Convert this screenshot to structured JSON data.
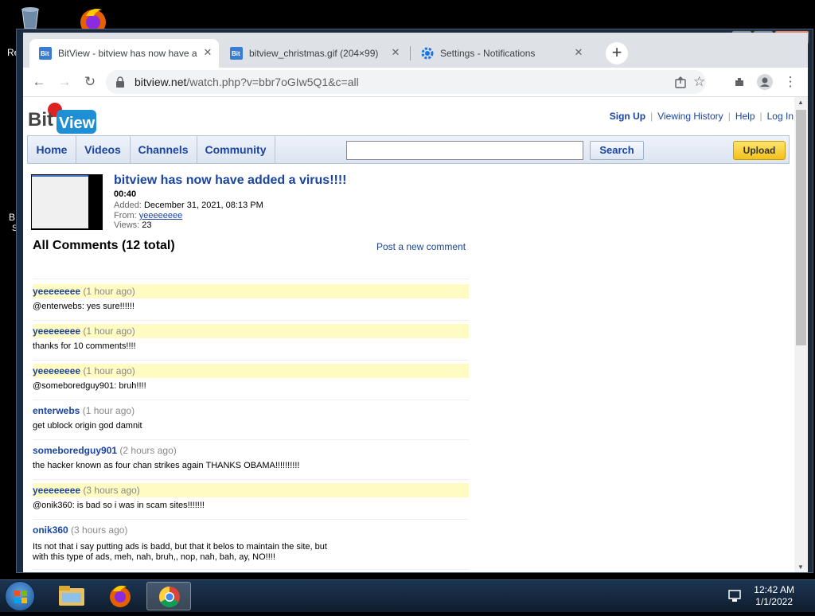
{
  "desktop": {
    "left_fragments": [
      "Re",
      "B",
      "S"
    ]
  },
  "window_controls": {
    "minimize": "—",
    "maximize": "☐",
    "close": "✕"
  },
  "tabs": [
    {
      "title": "BitView - bitview has now have a",
      "icon": "bitview-favicon"
    },
    {
      "title": "bitview_christmas.gif (204×99)",
      "icon": "bitview-favicon"
    },
    {
      "title": "Settings - Notifications",
      "icon": "gear-icon"
    }
  ],
  "new_tab": "+",
  "omnibox": {
    "domain": "bitview.net",
    "path": "/watch.php?v=bbr7oGIw5Q1&c=all"
  },
  "site": {
    "logo_top": "Bit",
    "logo_bottom": "View",
    "top_links": [
      "Sign Up",
      "Viewing History",
      "Help",
      "Log In"
    ],
    "nav": [
      "Home",
      "Videos",
      "Channels",
      "Community"
    ],
    "search_button": "Search",
    "upload_button": "Upload",
    "favicon_text": "Bit"
  },
  "video": {
    "title": "bitview has now have added a virus!!!!",
    "duration": "00:40",
    "added_label": "Added:",
    "added": "December 31, 2021, 08:13 PM",
    "from_label": "From:",
    "from": "yeeeeeeee",
    "views_label": "Views:",
    "views": "23"
  },
  "comments_section": {
    "header": "All Comments (12 total)",
    "post_link": "Post a new comment",
    "comments": [
      {
        "author": "yeeeeeeee",
        "time": "(1 hour ago)",
        "text": "@enterwebs: yes sure!!!!!!",
        "highlight": true
      },
      {
        "author": "yeeeeeeee",
        "time": "(1 hour ago)",
        "text": "thanks for 10 comments!!!!",
        "highlight": true
      },
      {
        "author": "yeeeeeeee",
        "time": "(1 hour ago)",
        "text": "@someboredguy901: bruh!!!!",
        "highlight": true
      },
      {
        "author": "enterwebs",
        "time": "(1 hour ago)",
        "text": "get ublock origin god damnit",
        "highlight": false
      },
      {
        "author": "someboredguy901",
        "time": "(2 hours ago)",
        "text": "the hacker known as four chan strikes again THANKS OBAMA!!!!!!!!!!",
        "highlight": false
      },
      {
        "author": "yeeeeeeee",
        "time": "(3 hours ago)",
        "text": "@onik360: is bad so i was in scam sites!!!!!!!",
        "highlight": true
      },
      {
        "author": "onik360",
        "time": "(3 hours ago)",
        "text": "Its not that i say putting ads is badd, but that it belos to maintain the site, but",
        "text2": "with this type of ads, meh, nah, bruh,, nop, nah, bah, ay, NO!!!!",
        "highlight": false
      }
    ]
  },
  "taskbar": {
    "time": "12:42 AM",
    "date": "1/1/2022"
  },
  "colors": {
    "link_blue": "#1a44a0",
    "highlight_yellow": "#fffbc3",
    "upload_yellow": "#f2c21b"
  }
}
